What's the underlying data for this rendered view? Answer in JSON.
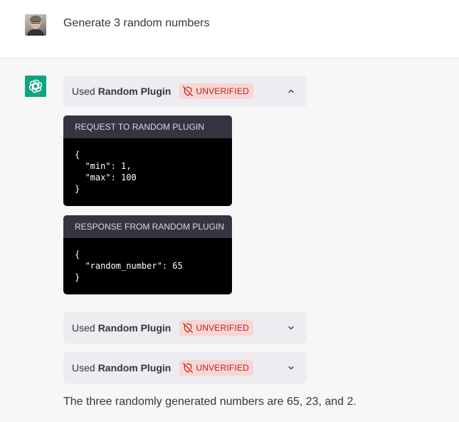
{
  "user_message": {
    "text": "Generate 3 random numbers"
  },
  "plugin_calls": [
    {
      "prefix": "Used",
      "plugin_name": "Random Plugin",
      "badge": "UNVERIFIED",
      "expanded": true,
      "chevron": "chevron-up-icon",
      "request_title": "REQUEST TO RANDOM PLUGIN",
      "request_body": "{\n  \"min\": 1,\n  \"max\": 100\n}",
      "response_title": "RESPONSE FROM RANDOM PLUGIN",
      "response_body": "{\n  \"random_number\": 65\n}"
    },
    {
      "prefix": "Used",
      "plugin_name": "Random Plugin",
      "badge": "UNVERIFIED",
      "expanded": false,
      "chevron": "chevron-down-icon"
    },
    {
      "prefix": "Used",
      "plugin_name": "Random Plugin",
      "badge": "UNVERIFIED",
      "expanded": false,
      "chevron": "chevron-down-icon"
    }
  ],
  "assistant_answer": "The three randomly generated numbers are 65, 23, and 2.",
  "colors": {
    "assistant_avatar": "#10a37f",
    "badge_bg": "#f9d5d5",
    "badge_text": "#b42318",
    "code_header": "#343541"
  }
}
